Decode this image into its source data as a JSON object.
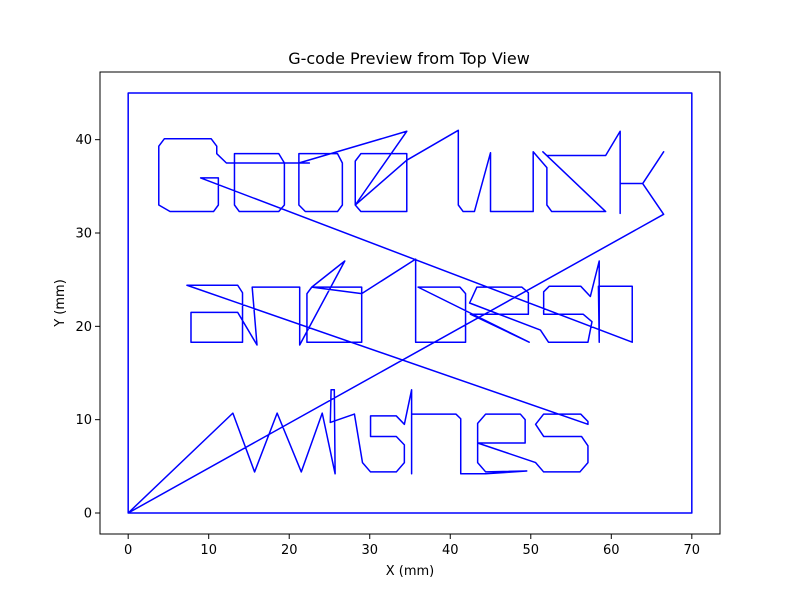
{
  "chart_data": {
    "type": "line",
    "title": "G-code Preview from Top View",
    "xlabel": "X (mm)",
    "ylabel": "Y (mm)",
    "xlim": [
      -3.5,
      73.5
    ],
    "ylim": [
      -2.25,
      47.25
    ],
    "xticks": [
      0,
      10,
      20,
      30,
      40,
      50,
      60,
      70
    ],
    "yticks": [
      0,
      10,
      20,
      30,
      40
    ],
    "grid": false,
    "line_color": "#0000ff",
    "series": [
      {
        "name": "",
        "points": [
          [
            0,
            0
          ],
          [
            0,
            45
          ],
          [
            70,
            45
          ],
          [
            70,
            0
          ],
          [
            0,
            0
          ],
          [
            13,
            10.7
          ],
          [
            15.7,
            4.4
          ],
          [
            18.5,
            10.7
          ],
          [
            21.5,
            4.4
          ],
          [
            24.1,
            10.7
          ],
          [
            25.7,
            4.2
          ],
          [
            25.6,
            13.2
          ],
          [
            25.2,
            13.2
          ],
          [
            25.1,
            9.7
          ],
          [
            28.1,
            10.6
          ],
          [
            29.1,
            5.4
          ],
          [
            30.1,
            4.4
          ],
          [
            33.3,
            4.4
          ],
          [
            34.3,
            5.4
          ],
          [
            34.3,
            7.3
          ],
          [
            33.3,
            8.2
          ],
          [
            30.1,
            8.2
          ],
          [
            30.1,
            10.4
          ],
          [
            33.3,
            10.4
          ],
          [
            34.3,
            9.5
          ],
          [
            35.2,
            13.2
          ],
          [
            35.2,
            4.2
          ],
          [
            35.2,
            10.6
          ],
          [
            40.7,
            10.6
          ],
          [
            41.3,
            10.1
          ],
          [
            41.3,
            4.2
          ],
          [
            44.4,
            4.2
          ],
          [
            49.5,
            4.5
          ],
          [
            44.4,
            4.4
          ],
          [
            43.4,
            5.4
          ],
          [
            43.4,
            9.6
          ],
          [
            44.4,
            10.6
          ],
          [
            48.7,
            10.6
          ],
          [
            49.3,
            10
          ],
          [
            49.3,
            7.5
          ],
          [
            43.4,
            7.5
          ],
          [
            50.6,
            5.4
          ],
          [
            51.6,
            4.4
          ],
          [
            56.1,
            4.4
          ],
          [
            57.1,
            5.4
          ],
          [
            57.1,
            7.2
          ],
          [
            56.3,
            8.2
          ],
          [
            51.6,
            8.2
          ],
          [
            50.6,
            9.5
          ],
          [
            51.6,
            10.6
          ],
          [
            56.2,
            10.6
          ],
          [
            57.1,
            9.8
          ],
          [
            57.1,
            9.5
          ],
          [
            7.3,
            24.4
          ],
          [
            13.6,
            24.4
          ],
          [
            14.2,
            23.6
          ],
          [
            14.2,
            18.3
          ],
          [
            7.8,
            18.3
          ],
          [
            7.8,
            21.5
          ],
          [
            13.6,
            21.5
          ],
          [
            16.0,
            18.0
          ],
          [
            15.4,
            24.2
          ],
          [
            21.3,
            24.2
          ],
          [
            21.3,
            18
          ],
          [
            26.9,
            27
          ],
          [
            22.8,
            24.2
          ],
          [
            29,
            24.2
          ],
          [
            29,
            18.3
          ],
          [
            22.2,
            18.3
          ],
          [
            22.2,
            23.5
          ],
          [
            22.8,
            24.2
          ],
          [
            29,
            23.5
          ],
          [
            35.7,
            27.2
          ],
          [
            35.7,
            18.3
          ],
          [
            41.9,
            18.3
          ],
          [
            41.9,
            23.5
          ],
          [
            41.2,
            24.2
          ],
          [
            36,
            24.2
          ],
          [
            49.8,
            18.3
          ],
          [
            42.5,
            21.3
          ],
          [
            49.7,
            21.3
          ],
          [
            49.7,
            23.6
          ],
          [
            48.9,
            24.2
          ],
          [
            43.3,
            24.2
          ],
          [
            42.4,
            22.5
          ],
          [
            51.2,
            19.6
          ],
          [
            52.2,
            18.3
          ],
          [
            57.1,
            18.3
          ],
          [
            57.6,
            20.5
          ],
          [
            56.5,
            21.3
          ],
          [
            51.6,
            21.3
          ],
          [
            51.6,
            23.7
          ],
          [
            52.3,
            24.3
          ],
          [
            56.2,
            24.3
          ],
          [
            57.4,
            23.2
          ],
          [
            58.5,
            27
          ],
          [
            58.5,
            18.3
          ],
          [
            58.4,
            24.3
          ],
          [
            62.6,
            24.3
          ],
          [
            62.6,
            18.3
          ],
          [
            9,
            35.9
          ],
          [
            11.2,
            35.9
          ],
          [
            11.2,
            33
          ],
          [
            10.6,
            32.3
          ],
          [
            5.2,
            32.3
          ],
          [
            3.8,
            33
          ],
          [
            3.8,
            39.3
          ],
          [
            4.5,
            40.1
          ],
          [
            10.3,
            40.1
          ],
          [
            11,
            39.3
          ],
          [
            11,
            38.5
          ],
          [
            12.2,
            37.5
          ],
          [
            13.2,
            37.5
          ],
          [
            13.2,
            38.5
          ],
          [
            18.7,
            38.5
          ],
          [
            19.4,
            37.5
          ],
          [
            19.4,
            33
          ],
          [
            18.7,
            32.3
          ],
          [
            13.8,
            32.3
          ],
          [
            13.2,
            33
          ],
          [
            13.2,
            37.5
          ],
          [
            22.5,
            37.5
          ],
          [
            21.2,
            37.5
          ],
          [
            21.2,
            38.5
          ],
          [
            26,
            38.5
          ],
          [
            26.6,
            37.5
          ],
          [
            26.6,
            33
          ],
          [
            26,
            32.3
          ],
          [
            22,
            32.3
          ],
          [
            21.2,
            33
          ],
          [
            21.2,
            37.5
          ],
          [
            34.6,
            40.9
          ],
          [
            28.2,
            33
          ],
          [
            28.9,
            32.3
          ],
          [
            34.6,
            32.3
          ],
          [
            34.6,
            38.5
          ],
          [
            28.9,
            38.5
          ],
          [
            28.2,
            37.7
          ],
          [
            28.2,
            33
          ],
          [
            34.6,
            37.8
          ],
          [
            41,
            41
          ],
          [
            41,
            33
          ],
          [
            41.6,
            32.3
          ],
          [
            43,
            32.3
          ],
          [
            45,
            38.6
          ],
          [
            45,
            32.3
          ],
          [
            50.3,
            32.3
          ],
          [
            50.3,
            38.7
          ],
          [
            52,
            37
          ],
          [
            52,
            33
          ],
          [
            52.6,
            32.3
          ],
          [
            59.3,
            32.3
          ],
          [
            51.5,
            38.7
          ],
          [
            52,
            38.3
          ],
          [
            59.3,
            38.3
          ],
          [
            61.1,
            40.9
          ],
          [
            61.1,
            32.1
          ],
          [
            61.1,
            35.3
          ],
          [
            63.9,
            35.3
          ],
          [
            66.5,
            38.7
          ],
          [
            63.9,
            35.3
          ],
          [
            66.5,
            32
          ],
          [
            0,
            0
          ]
        ]
      }
    ]
  }
}
